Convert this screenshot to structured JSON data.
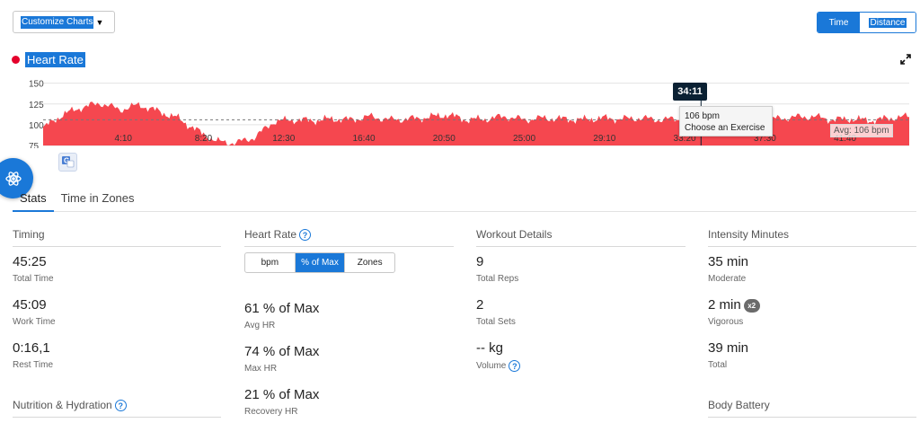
{
  "toolbar": {
    "customize_label": "Customize Charts",
    "time_label": "Time",
    "distance_label": "Distance"
  },
  "chart": {
    "title": "Heart Rate",
    "y_ticks": [
      "150",
      "125",
      "100",
      "75"
    ],
    "x_ticks": [
      "4:10",
      "8:20",
      "12:30",
      "16:40",
      "20:50",
      "25:00",
      "29:10",
      "33:20",
      "37:30",
      "41:40"
    ],
    "tooltip_time": "34:11",
    "tooltip_value": "106 bpm",
    "tooltip_exercise": "Choose an Exercise",
    "avg_label": "Avg: 106 bpm",
    "series_color": "#f5474f",
    "avg": 106
  },
  "chart_data": {
    "type": "area",
    "title": "Heart Rate",
    "ylim": [
      75,
      155
    ],
    "x_minutes": [
      0,
      1,
      2,
      3,
      4,
      5,
      6,
      7,
      8,
      9,
      10,
      11,
      12,
      13,
      14,
      15,
      16,
      17,
      18,
      19,
      20,
      21,
      22,
      23,
      24,
      25,
      26,
      27,
      28,
      29,
      30,
      31,
      32,
      33,
      34,
      35,
      36,
      37,
      38,
      39,
      40,
      41,
      42,
      43,
      44,
      45
    ],
    "values": [
      96,
      112,
      121,
      126,
      118,
      124,
      116,
      108,
      93,
      80,
      78,
      85,
      104,
      106,
      105,
      107,
      106,
      110,
      106,
      107,
      109,
      112,
      106,
      107,
      110,
      106,
      108,
      107,
      106,
      108,
      107,
      108,
      106,
      107,
      106,
      111,
      106,
      108,
      107,
      109,
      110,
      106,
      107,
      105,
      108,
      110
    ],
    "average": 106
  },
  "tabs": [
    "Stats",
    "Time in Zones"
  ],
  "timing": {
    "title": "Timing",
    "items": [
      {
        "value": "45:25",
        "label": "Total Time"
      },
      {
        "value": "45:09",
        "label": "Work Time"
      },
      {
        "value": "0:16,1",
        "label": "Rest Time"
      }
    ]
  },
  "heart_rate": {
    "title": "Heart Rate",
    "seg": [
      "bpm",
      "% of Max",
      "Zones"
    ],
    "items": [
      {
        "value": "61 % of Max",
        "label": "Avg HR"
      },
      {
        "value": "74 % of Max",
        "label": "Max HR"
      },
      {
        "value": "21 % of Max",
        "label": "Recovery HR"
      }
    ]
  },
  "workout": {
    "title": "Workout Details",
    "items": [
      {
        "value": "9",
        "label": "Total Reps"
      },
      {
        "value": "2",
        "label": "Total Sets"
      },
      {
        "value": "-- kg",
        "label": "Volume"
      }
    ]
  },
  "intensity": {
    "title": "Intensity Minutes",
    "items": [
      {
        "value": "35 min",
        "label": "Moderate"
      },
      {
        "value": "2 min",
        "label": "Vigorous",
        "badge": "x2"
      },
      {
        "value": "39 min",
        "label": "Total"
      }
    ]
  },
  "nutrition": {
    "title": "Nutrition & Hydration"
  },
  "body_battery": {
    "title": "Body Battery"
  }
}
